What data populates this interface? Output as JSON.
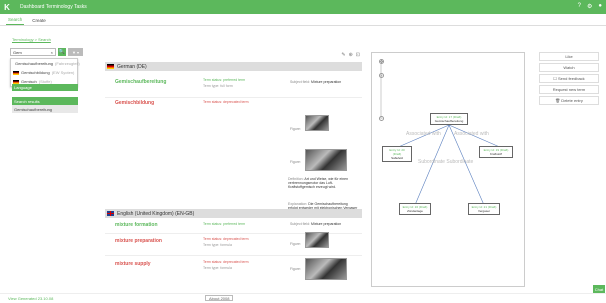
{
  "topbar": {
    "logo": "K",
    "nav": "Dashboard  Terminology  Tasks",
    "icons": [
      "help-icon",
      "gear-icon",
      "user-icon"
    ],
    "help": "?",
    "gear": "⚙",
    "user": "●"
  },
  "subtabs": [
    "Search",
    "Create"
  ],
  "breadcrumb": "Terminology > Search",
  "search": {
    "value": "Gem",
    "clear": "×",
    "search_icon": "🔍",
    "filter": "▼ ▾"
  },
  "suggestions": [
    {
      "term": "Gemischaufbereitung",
      "sub": "(Fahrzeugteil)"
    },
    {
      "term": "Gemischbildung",
      "sub": "(EW Syoten)"
    },
    {
      "term": "Gemisch",
      "sub": "(Stoffe)"
    }
  ],
  "language_select": "Language",
  "results": {
    "header": "Search results",
    "item": "Gemischaufbereitung"
  },
  "main": {
    "tools": [
      "✎",
      "⊕",
      "⊡"
    ],
    "german": {
      "header": "German (DE)",
      "terms": [
        {
          "term": "Gemischaufbereitung",
          "status": "Term status: preferred term",
          "type": "Term type: full form"
        },
        {
          "term": "Gemischbildung",
          "status": "Term status: deprecated term",
          "type": ""
        }
      ],
      "subject_label": "Subject field:",
      "subject": "Mixture preparation",
      "figure_label": "Figure:",
      "def_label": "Definition:",
      "definition": "Art und Weise, wie für einen verbrennungsmotor das Luft-Kraftstoffgemisch erzeugt wird.",
      "exp_label": "Explanation:",
      "explanation": "Die Gemischaufbereitung erfolgt entweder mit elektronischen Vergaser oder Vergaser."
    },
    "english": {
      "header": "English (United Kingdom) (EN-GB)",
      "terms": [
        {
          "term": "mixture formation",
          "status": "Term status: preferred term",
          "type": ""
        },
        {
          "term": "mixture preparation",
          "status": "Term status: deprecated term",
          "type": "Term type: formula"
        },
        {
          "term": "mixture supply",
          "status": "Term status: deprecated term",
          "type": "Term type: formula"
        }
      ],
      "subject_label": "Subject field:",
      "subject": "Mixture preparation",
      "figure_label": "Figure:"
    }
  },
  "graph": {
    "center": {
      "id": "Entry Id: 17 (Draft)",
      "term": "Gemischaufbereitung"
    },
    "left": {
      "id": "Entry Id: 20 (Draft)",
      "term": "Saftefeld"
    },
    "right": {
      "id": "Entry Id: 19 (Draft)",
      "term": "Kraftstoff"
    },
    "bottom_left": {
      "id": "Entry Id: 16 (Draft)",
      "term": "Zündanlage"
    },
    "bottom_right": {
      "id": "Entry Id: 21 (Draft)",
      "term": "Vergaser"
    },
    "rel_assoc_left": "Associated with",
    "rel_assoc_right": "Associated with",
    "rel_sub": "Subordinate Subordinate"
  },
  "right_panel": [
    "Like",
    "Watch",
    "☐ Send feedback",
    "Request new term",
    "🗑 Delete entry"
  ],
  "footer": {
    "left": "View Generated 23.10.08",
    "mid": "About 2008"
  },
  "chat": "Chat",
  "colors": {
    "accent": "#5cb85c",
    "deprecated": "#d9534f"
  }
}
